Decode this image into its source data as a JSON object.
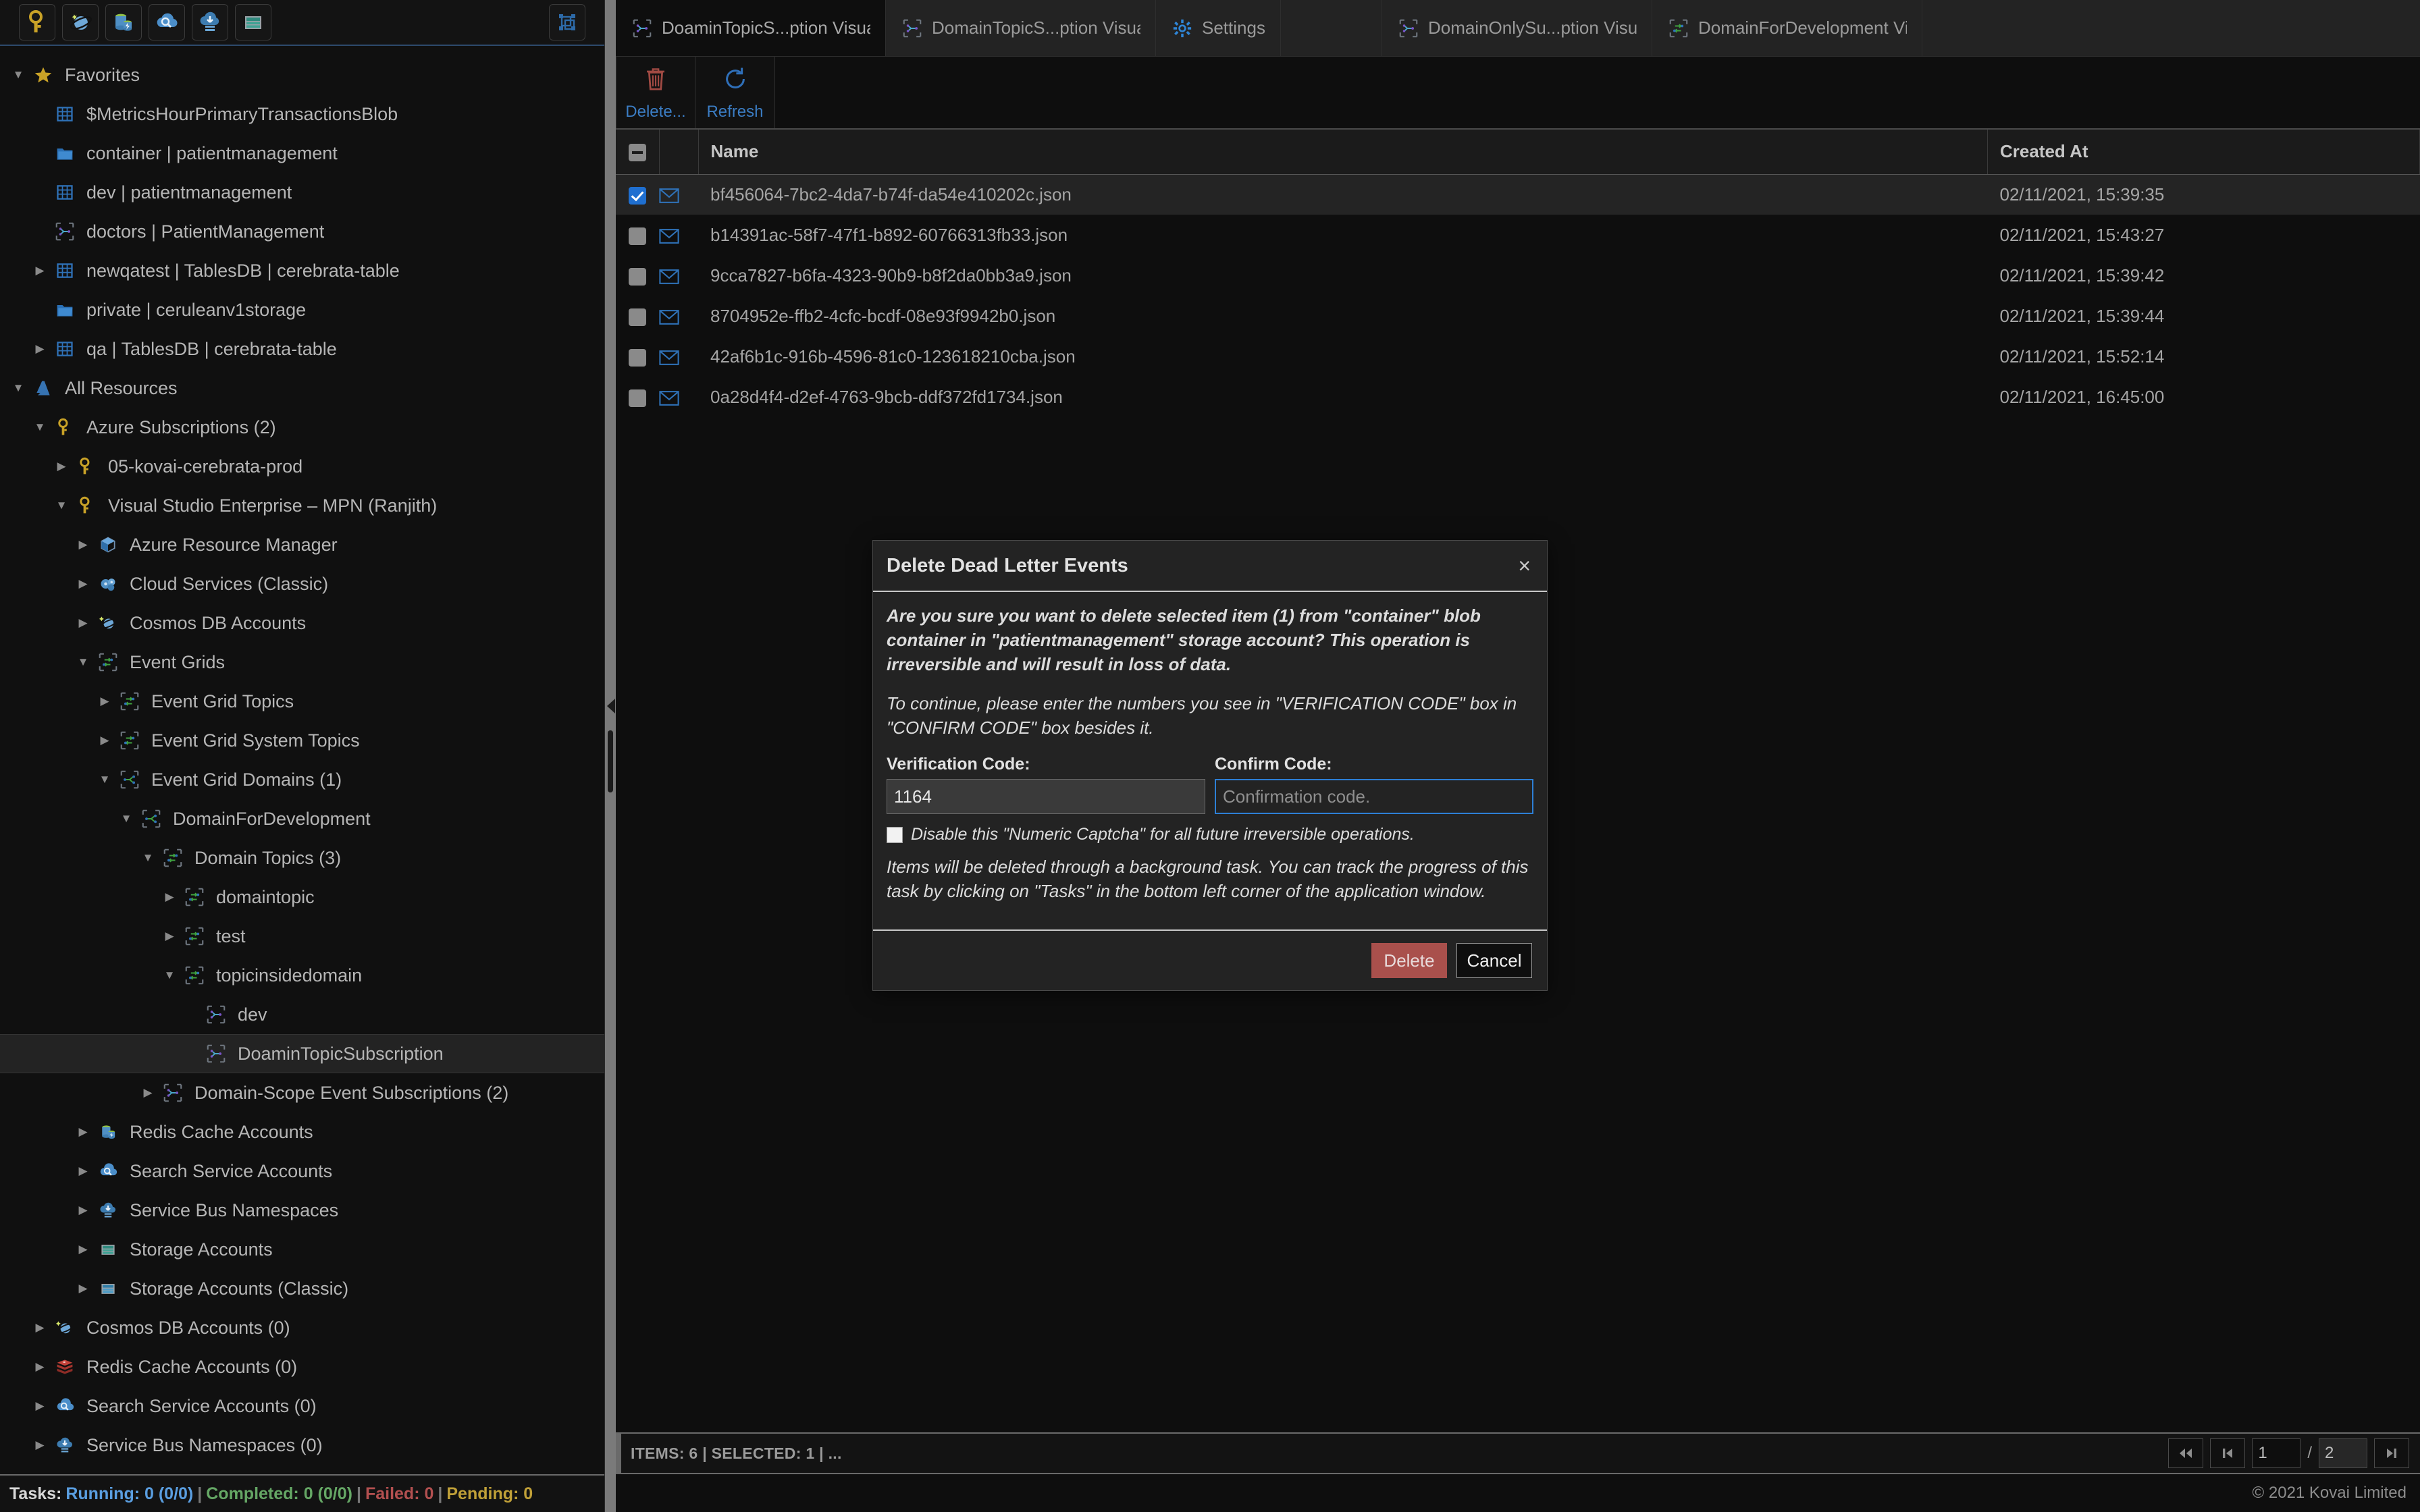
{
  "left_toolbar": {
    "buttons": [
      {
        "name": "azure-key-icon",
        "label": "Key"
      },
      {
        "name": "cosmos-db-icon",
        "label": "Cosmos DB"
      },
      {
        "name": "redis-cache-icon",
        "label": "Redis Cache"
      },
      {
        "name": "search-service-icon",
        "label": "Search Service"
      },
      {
        "name": "service-bus-icon",
        "label": "Service Bus"
      },
      {
        "name": "storage-account-icon",
        "label": "Storage Account"
      }
    ],
    "right_button": {
      "name": "resource-layout-icon",
      "label": "Layout"
    }
  },
  "tree": [
    {
      "indent": 0,
      "twisty": "down",
      "icon": "star",
      "label": "Favorites"
    },
    {
      "indent": 1,
      "twisty": "none",
      "icon": "table",
      "label": "$MetricsHourPrimaryTransactionsBlob"
    },
    {
      "indent": 1,
      "twisty": "none",
      "icon": "folder",
      "label": "container | patientmanagement"
    },
    {
      "indent": 1,
      "twisty": "none",
      "icon": "table",
      "label": "dev | patientmanagement"
    },
    {
      "indent": 1,
      "twisty": "none",
      "icon": "subscript",
      "label": "doctors | PatientManagement"
    },
    {
      "indent": 1,
      "twisty": "right",
      "icon": "table",
      "label": "newqatest | TablesDB | cerebrata-table"
    },
    {
      "indent": 1,
      "twisty": "none",
      "icon": "folder",
      "label": "private | ceruleanv1storage"
    },
    {
      "indent": 1,
      "twisty": "right",
      "icon": "table",
      "label": "qa | TablesDB | cerebrata-table"
    },
    {
      "indent": 0,
      "twisty": "down",
      "icon": "azure",
      "label": "All Resources"
    },
    {
      "indent": 1,
      "twisty": "down",
      "icon": "key",
      "label": "Azure Subscriptions (2)"
    },
    {
      "indent": 2,
      "twisty": "right",
      "icon": "key",
      "label": "05-kovai-cerebrata-prod"
    },
    {
      "indent": 2,
      "twisty": "down",
      "icon": "key",
      "label": "Visual Studio Enterprise – MPN (Ranjith)"
    },
    {
      "indent": 3,
      "twisty": "right",
      "icon": "arm",
      "label": "Azure Resource Manager"
    },
    {
      "indent": 3,
      "twisty": "right",
      "icon": "cloudsvc",
      "label": "Cloud Services (Classic)"
    },
    {
      "indent": 3,
      "twisty": "right",
      "icon": "cosmos",
      "label": "Cosmos DB Accounts"
    },
    {
      "indent": 3,
      "twisty": "down",
      "icon": "eventgrid",
      "label": "Event Grids"
    },
    {
      "indent": 4,
      "twisty": "right",
      "icon": "eventgrid",
      "label": "Event Grid Topics"
    },
    {
      "indent": 4,
      "twisty": "right",
      "icon": "eventgrid",
      "label": "Event Grid System Topics"
    },
    {
      "indent": 4,
      "twisty": "down",
      "icon": "egdomain",
      "label": "Event Grid Domains (1)"
    },
    {
      "indent": 5,
      "twisty": "down",
      "icon": "egdomain",
      "label": "DomainForDevelopment"
    },
    {
      "indent": 6,
      "twisty": "down",
      "icon": "eventgrid",
      "label": "Domain Topics (3)"
    },
    {
      "indent": 7,
      "twisty": "right",
      "icon": "eventgrid",
      "label": "domaintopic"
    },
    {
      "indent": 7,
      "twisty": "right",
      "icon": "eventgrid",
      "label": "test"
    },
    {
      "indent": 7,
      "twisty": "down",
      "icon": "eventgrid",
      "label": "topicinsidedomain"
    },
    {
      "indent": 8,
      "twisty": "none",
      "icon": "subscript",
      "label": "dev"
    },
    {
      "indent": 8,
      "twisty": "none",
      "icon": "subscript",
      "label": "DoaminTopicSubscription",
      "selected": true
    },
    {
      "indent": 6,
      "twisty": "right",
      "icon": "subscript",
      "label": "Domain-Scope Event Subscriptions (2)"
    },
    {
      "indent": 3,
      "twisty": "right",
      "icon": "redis",
      "label": "Redis Cache Accounts"
    },
    {
      "indent": 3,
      "twisty": "right",
      "icon": "search",
      "label": "Search Service Accounts"
    },
    {
      "indent": 3,
      "twisty": "right",
      "icon": "servicebus",
      "label": "Service Bus Namespaces"
    },
    {
      "indent": 3,
      "twisty": "right",
      "icon": "storage",
      "label": "Storage Accounts"
    },
    {
      "indent": 3,
      "twisty": "right",
      "icon": "storagecl",
      "label": "Storage Accounts (Classic)"
    },
    {
      "indent": 1,
      "twisty": "right",
      "icon": "cosmos",
      "label": "Cosmos DB Accounts (0)"
    },
    {
      "indent": 1,
      "twisty": "right",
      "icon": "redis2",
      "label": "Redis Cache Accounts (0)"
    },
    {
      "indent": 1,
      "twisty": "right",
      "icon": "search",
      "label": "Search Service Accounts (0)"
    },
    {
      "indent": 1,
      "twisty": "right",
      "icon": "servicebus",
      "label": "Service Bus Namespaces (0)"
    }
  ],
  "tasks": {
    "label": "Tasks:",
    "running": "Running: 0 (0/0)",
    "completed": "Completed: 0 (0/0)",
    "failed": "Failed: 0",
    "pending": "Pending: 0",
    "separator": "|",
    "colors": {
      "running": "#5a9ee0",
      "completed": "#65a765",
      "failed": "#b35050",
      "pending": "#c0a038"
    }
  },
  "tabs": [
    {
      "label": "DoaminTopicS...ption Visua",
      "icon": "subscription-icon",
      "active": true
    },
    {
      "label": "DomainTopicS...ption Visua",
      "icon": "subscription-icon",
      "active": false
    },
    {
      "label": "Settings",
      "icon": "gear-icon",
      "active": false
    },
    {
      "label": "DomainOnlySu...ption Visu",
      "icon": "subscription-icon",
      "active": false
    },
    {
      "label": "DomainForDevelopment Vi",
      "icon": "eventgrid-icon",
      "active": false
    }
  ],
  "content_toolbar": [
    {
      "label": "Delete...",
      "icon": "trash-icon"
    },
    {
      "label": "Refresh",
      "icon": "refresh-icon"
    }
  ],
  "table": {
    "columns": [
      "",
      "",
      "Name",
      "Created At"
    ],
    "header_checkbox_state": "partial",
    "rows": [
      {
        "checked": true,
        "selected": true,
        "name": "bf456064-7bc2-4da7-b74f-da54e410202c.json",
        "created_at": "02/11/2021, 15:39:35"
      },
      {
        "checked": false,
        "selected": false,
        "name": "b14391ac-58f7-47f1-b892-60766313fb33.json",
        "created_at": "02/11/2021, 15:43:27"
      },
      {
        "checked": false,
        "selected": false,
        "name": "9cca7827-b6fa-4323-90b9-b8f2da0bb3a9.json",
        "created_at": "02/11/2021, 15:39:42"
      },
      {
        "checked": false,
        "selected": false,
        "name": "8704952e-ffb2-4cfc-bcdf-08e93f9942b0.json",
        "created_at": "02/11/2021, 15:39:44"
      },
      {
        "checked": false,
        "selected": false,
        "name": "42af6b1c-916b-4596-81c0-123618210cba.json",
        "created_at": "02/11/2021, 15:52:14"
      },
      {
        "checked": false,
        "selected": false,
        "name": "0a28d4f4-d2ef-4763-9bcb-ddf372fd1734.json",
        "created_at": "02/11/2021, 16:45:00"
      }
    ]
  },
  "status": {
    "text": "ITEMS: 6 | SELECTED: 1 |  ..."
  },
  "pager": {
    "first_icon": "double-left-icon",
    "prev_icon": "step-left-icon",
    "current_page": "1",
    "separator": "/",
    "total_pages": "2",
    "last_icon": "step-right-icon"
  },
  "footer": {
    "copyright": "© 2021 Kovai Limited"
  },
  "modal": {
    "title": "Delete Dead Letter Events",
    "close_label": "×",
    "paragraph1": "Are you sure you want to delete selected item (1) from \"container\" blob container in \"patientmanagement\" storage account? This operation is irreversible and will result in loss of data.",
    "paragraph2": "To continue, please enter the numbers you see in \"VERIFICATION CODE\" box in \"CONFIRM CODE\" box besides it.",
    "verification_label": "Verification Code:",
    "verification_value": "1164",
    "confirm_label": "Confirm Code:",
    "confirm_value": "",
    "confirm_placeholder": "Confirmation code.",
    "checkbox_label": "Disable this \"Numeric Captcha\" for all future irreversible operations.",
    "checkbox_checked": false,
    "paragraph3": "Items will be deleted through a background task. You can track the progress of this task by clicking on \"Tasks\" in the bottom left corner of the application window.",
    "delete_label": "Delete",
    "cancel_label": "Cancel",
    "delete_color": "#a9504c"
  }
}
